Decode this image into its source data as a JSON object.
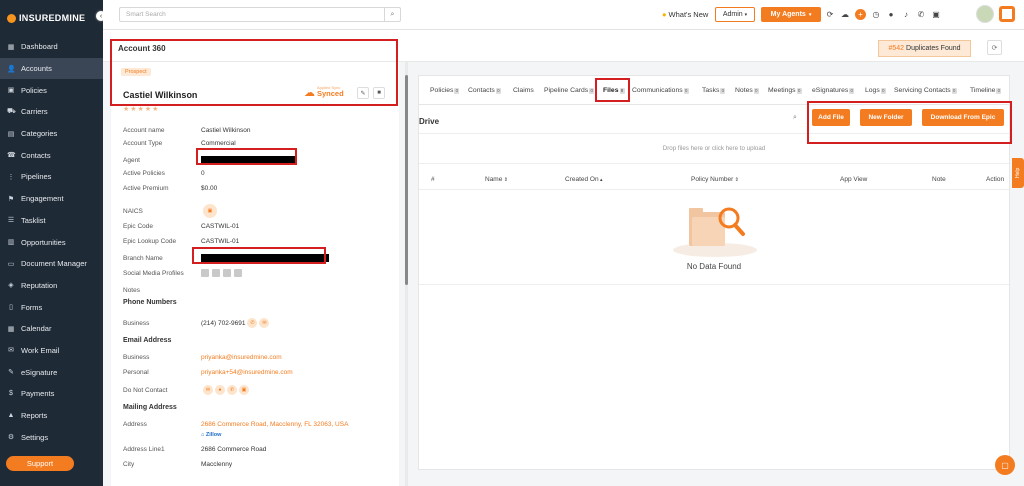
{
  "brand": {
    "name": "INSUREDMINE"
  },
  "sidebar": {
    "items": [
      {
        "label": "Dashboard",
        "icon": "dashboard-icon",
        "glyph": "▦"
      },
      {
        "label": "Accounts",
        "icon": "accounts-icon",
        "glyph": "👤"
      },
      {
        "label": "Policies",
        "icon": "policies-icon",
        "glyph": "▣"
      },
      {
        "label": "Carriers",
        "icon": "carriers-icon",
        "glyph": "⛟"
      },
      {
        "label": "Categories",
        "icon": "categories-icon",
        "glyph": "▤"
      },
      {
        "label": "Contacts",
        "icon": "contacts-icon",
        "glyph": "☎"
      },
      {
        "label": "Pipelines",
        "icon": "pipelines-icon",
        "glyph": "⋮"
      },
      {
        "label": "Engagement",
        "icon": "engagement-icon",
        "glyph": "⚑"
      },
      {
        "label": "Tasklist",
        "icon": "tasklist-icon",
        "glyph": "☰"
      },
      {
        "label": "Opportunities",
        "icon": "opportunities-icon",
        "glyph": "▥"
      },
      {
        "label": "Document Manager",
        "icon": "document-manager-icon",
        "glyph": "▭"
      },
      {
        "label": "Reputation",
        "icon": "reputation-icon",
        "glyph": "◈"
      },
      {
        "label": "Forms",
        "icon": "forms-icon",
        "glyph": "▯"
      },
      {
        "label": "Calendar",
        "icon": "calendar-icon",
        "glyph": "▦"
      },
      {
        "label": "Work Email",
        "icon": "work-email-icon",
        "glyph": "✉"
      },
      {
        "label": "eSignature",
        "icon": "esignature-icon",
        "glyph": "✎"
      },
      {
        "label": "Payments",
        "icon": "payments-icon",
        "glyph": "$"
      },
      {
        "label": "Reports",
        "icon": "reports-icon",
        "glyph": "▲"
      },
      {
        "label": "Settings",
        "icon": "settings-icon",
        "glyph": "⚙"
      }
    ],
    "active": "Accounts",
    "support_label": "Support"
  },
  "topbar": {
    "search_placeholder": "Smart Search",
    "whats_new": "What's New",
    "admin_label": "Admin",
    "my_agents": "My Agents"
  },
  "header": {
    "title": "Account 360",
    "duplicates_count": "#542",
    "duplicates_label": "Duplicates Found"
  },
  "account": {
    "status_badge": "Prospect",
    "name": "Castiel Wilkinson",
    "applied_sync_label": "Applied Sync",
    "synced_label": "Synced",
    "fields": [
      {
        "label": "Account name",
        "value": "Castiel Wilkinson"
      },
      {
        "label": "Account Type",
        "value": "Commercial"
      },
      {
        "label": "Agent",
        "value": ""
      },
      {
        "label": "Active Policies",
        "value": "0"
      },
      {
        "label": "Active Premium",
        "value": "$0.00"
      },
      {
        "label": "NAICS",
        "value": ""
      },
      {
        "label": "Epic Code",
        "value": "CASTWIL-01"
      },
      {
        "label": "Epic Lookup Code",
        "value": "CASTWIL-01"
      },
      {
        "label": "Branch Name",
        "value": ""
      },
      {
        "label": "Social Media Profiles",
        "value": ""
      },
      {
        "label": "Notes",
        "value": ""
      }
    ],
    "phone_section": "Phone Numbers",
    "phone_label": "Business",
    "phone_value": "(214) 702-9691",
    "email_section": "Email Address",
    "email_business_label": "Business",
    "email_business": "priyanka@insuredmine.com",
    "email_personal_label": "Personal",
    "email_personal": "priyanka+54@insuredmine.com",
    "dnc_label": "Do Not Contact",
    "mailing_section": "Mailing Address",
    "address_label": "Address",
    "address_value": "2686 Commerce Road, Macclenny, FL 32063, USA",
    "zillow": "Zillow",
    "address1_label": "Address Line1",
    "address1_value": "2686 Commerce Road",
    "city_label": "City",
    "city_value": "Macclenny"
  },
  "tabs": [
    {
      "label": "Policies",
      "count": "0"
    },
    {
      "label": "Contacts",
      "count": "0"
    },
    {
      "label": "Claims",
      "count": ""
    },
    {
      "label": "Pipeline Cards",
      "count": "0"
    },
    {
      "label": "Files",
      "count": "0"
    },
    {
      "label": "Communications",
      "count": "0"
    },
    {
      "label": "Tasks",
      "count": "0"
    },
    {
      "label": "Notes",
      "count": "0"
    },
    {
      "label": "Meetings",
      "count": "0"
    },
    {
      "label": "eSignatures",
      "count": "0"
    },
    {
      "label": "Logs",
      "count": "0"
    },
    {
      "label": "Servicing Contacts",
      "count": "0"
    },
    {
      "label": "Timeline",
      "count": "0"
    }
  ],
  "active_tab": "Files",
  "drive": {
    "title": "Drive",
    "add_file": "Add File",
    "new_folder": "New Folder",
    "download_epic": "Download From Epic",
    "dropzone": "Drop files here or click here to upload",
    "columns": [
      "#",
      "Name",
      "Created On",
      "Policy Number",
      "App View",
      "Note",
      "Action"
    ],
    "empty": "No Data Found"
  },
  "help_label": "Help",
  "colors": {
    "accent": "#f47c20",
    "sidebar": "#1f2a37",
    "highlight": "#d31f1f"
  }
}
